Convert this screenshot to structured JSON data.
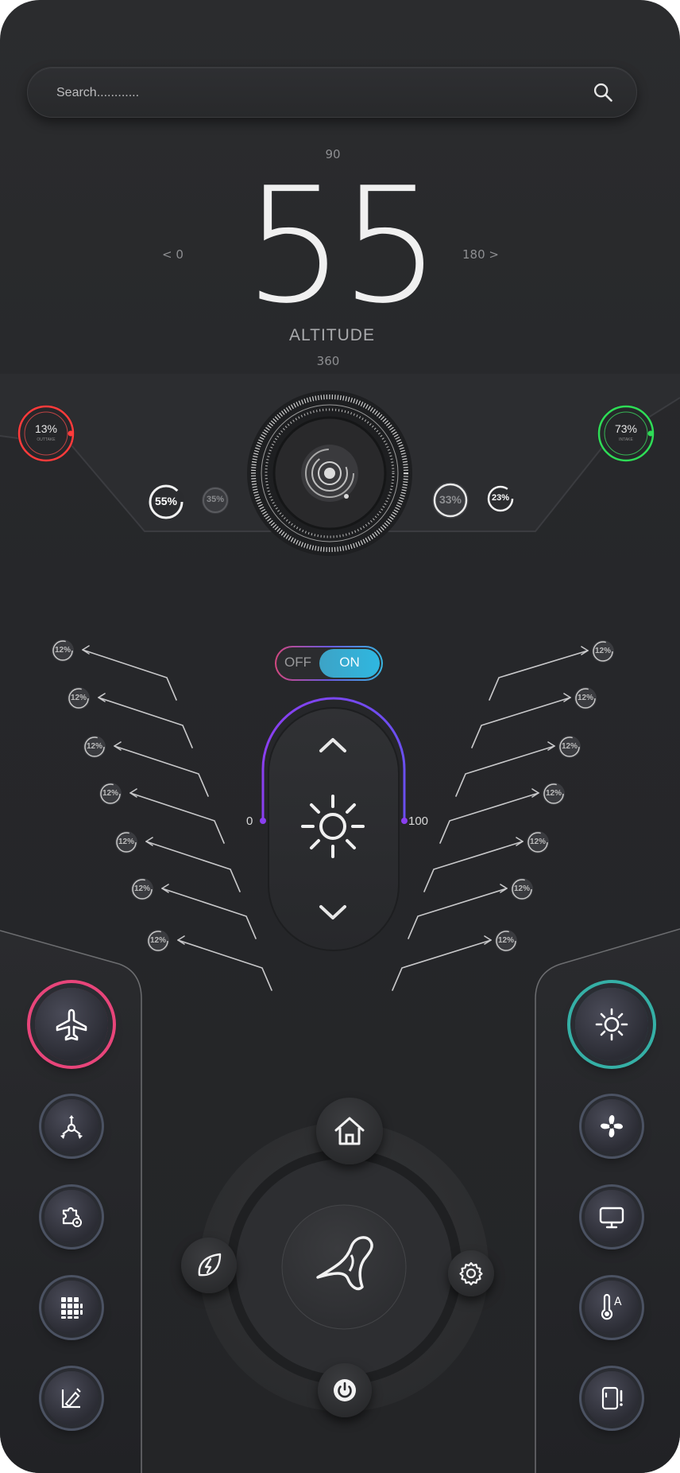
{
  "search": {
    "placeholder": "Search............"
  },
  "altitude": {
    "value": "55",
    "label": "ALTITUDE",
    "top_mark": "90",
    "bottom_mark": "360",
    "left_mark": "<  0",
    "right_mark": "180  >"
  },
  "gauges": {
    "left_main": {
      "value": "13%",
      "caption": "OUTTAKE",
      "color": "#ff3b3b"
    },
    "right_main": {
      "value": "73%",
      "caption": "INTAKE",
      "color": "#2edc56"
    },
    "left_a": "55%",
    "left_b": "35%",
    "right_a": "33%",
    "right_b": "23%"
  },
  "toggle": {
    "off_label": "OFF",
    "on_label": "ON",
    "state": "on"
  },
  "brightness": {
    "min": "0",
    "max": "100"
  },
  "branch_value": "12%",
  "left_buttons": [
    "airplane-icon",
    "network-icon",
    "puzzle-gear-icon",
    "grid-icon",
    "chart-edit-icon"
  ],
  "right_buttons": [
    "sun-icon",
    "fan-icon",
    "monitor-icon",
    "thermometer-auto-icon",
    "fridge-alert-icon"
  ],
  "controller": {
    "center": "plane-ribbon-icon",
    "top": "home-icon",
    "left": "eco-icon",
    "right": "gear-icon",
    "bottom": "power-icon"
  },
  "colors": {
    "accent_red": "#ff3b3b",
    "accent_green": "#2edc56",
    "accent_cyan": "#38b6e0",
    "accent_purple": "#7a4ff0",
    "accent_pink": "#e8457a"
  }
}
